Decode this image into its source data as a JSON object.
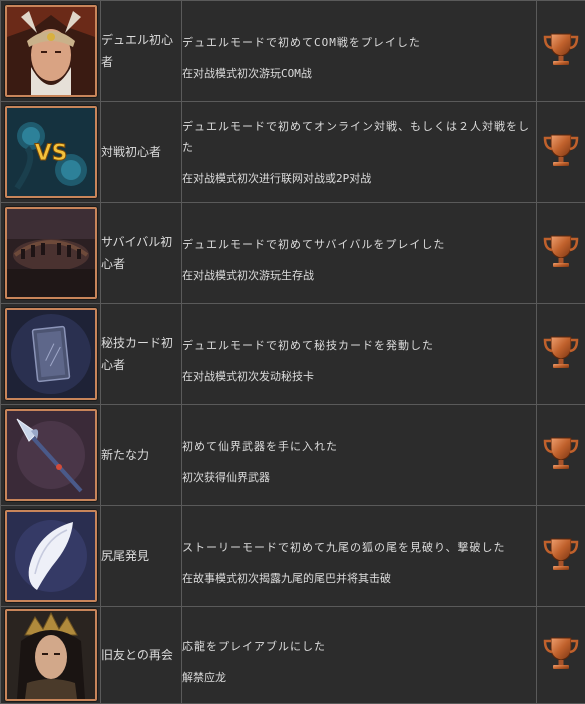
{
  "trophies": [
    {
      "icon": "warrior-portrait-icon",
      "name": "デュエル初心者",
      "desc_jp": "デュエルモードで初めてCOM戦をプレイした",
      "desc_cn": "在对战模式初次游玩COM战",
      "tier": "bronze"
    },
    {
      "icon": "vs-duel-icon",
      "name": "対戦初心者",
      "desc_jp": "デュエルモードで初めてオンライン対戦、もしくは２人対戦をした",
      "desc_cn": "在对战模式初次进行联网对战或2P对战",
      "tier": "bronze"
    },
    {
      "icon": "arena-icon",
      "name": "サバイバル初心者",
      "desc_jp": "デュエルモードで初めてサバイバルをプレイした",
      "desc_cn": "在对战模式初次游玩生存战",
      "tier": "bronze"
    },
    {
      "icon": "secret-card-icon",
      "name": "秘技カード初心者",
      "desc_jp": "デュエルモードで初めて秘技カードを発動した",
      "desc_cn": "在对战模式初次发动秘技卡",
      "tier": "bronze"
    },
    {
      "icon": "glaive-weapon-icon",
      "name": "新たな力",
      "desc_jp": "初めて仙界武器を手に入れた",
      "desc_cn": "初次获得仙界武器",
      "tier": "bronze"
    },
    {
      "icon": "fox-tail-icon",
      "name": "尻尾発見",
      "desc_jp": "ストーリーモードで初めて九尾の狐の尾を見破り、撃破した",
      "desc_cn": "在故事模式初次揭露九尾的尾巴并将其击破",
      "tier": "bronze"
    },
    {
      "icon": "ying-long-portrait-icon",
      "name": "旧友との再会",
      "desc_jp": "応龍をプレイアブルにした",
      "desc_cn": "解禁应龙",
      "tier": "bronze"
    }
  ],
  "colors": {
    "bronze": "#c06a35",
    "frame": "#c8855a",
    "background": "#2c2c2c",
    "border": "#5a5a5a"
  }
}
